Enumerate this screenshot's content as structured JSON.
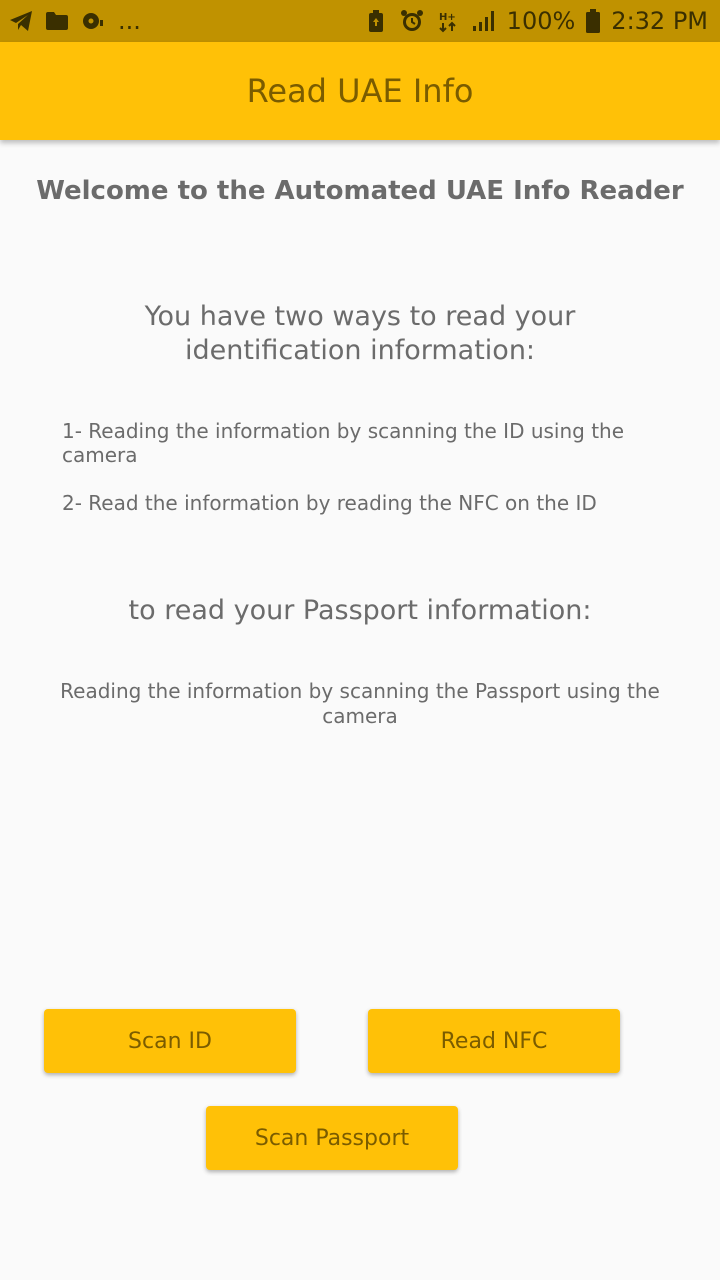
{
  "status_bar": {
    "dots": "...",
    "battery_percent": "100%",
    "time": "2:32 PM",
    "icons_left": [
      "telegram-icon",
      "folder-icon",
      "media-icon"
    ],
    "icons_right": [
      "battery-saver-icon",
      "alarm-icon",
      "hplus-data-icon",
      "signal-icon",
      "battery-icon"
    ]
  },
  "app_bar": {
    "title": "Read UAE Info"
  },
  "main": {
    "welcome": "Welcome to the Automated UAE Info Reader",
    "two_ways": "You have two ways to read your identification information:",
    "item1": "1- Reading the information by scanning the ID using the camera",
    "item2": "2- Read the information by reading the NFC on the ID",
    "passport_heading": "to read your Passport information:",
    "passport_desc": "Reading the information by scanning the Passport using the camera"
  },
  "buttons": {
    "scan_id": "Scan ID",
    "read_nfc": "Read NFC",
    "scan_passport": "Scan Passport"
  },
  "colors": {
    "status_bar": "#c09200",
    "app_bar": "#ffc107",
    "button": "#ffc107",
    "title_text": "#7a5c00",
    "body_text": "#6b6b6b",
    "background": "#fafafa"
  }
}
